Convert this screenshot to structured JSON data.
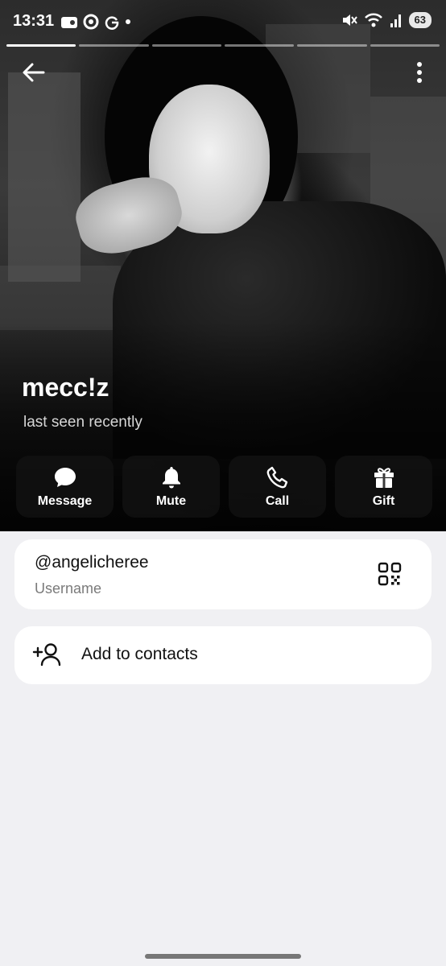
{
  "status_bar": {
    "time": "13:31",
    "battery": "63",
    "icons": [
      "gallery-icon",
      "circle-icon",
      "google-icon",
      "dot-icon",
      "mute-icon",
      "wifi-icon",
      "signal-icon",
      "battery-icon"
    ]
  },
  "profile": {
    "name": "mecc!z",
    "last_seen": "last seen recently"
  },
  "actions": [
    {
      "label": "Message",
      "icon": "message-icon"
    },
    {
      "label": "Mute",
      "icon": "bell-icon"
    },
    {
      "label": "Call",
      "icon": "phone-icon"
    },
    {
      "label": "Gift",
      "icon": "gift-icon"
    }
  ],
  "info": {
    "username": "@angelicheree",
    "username_label": "Username",
    "add_contact_label": "Add to contacts"
  }
}
